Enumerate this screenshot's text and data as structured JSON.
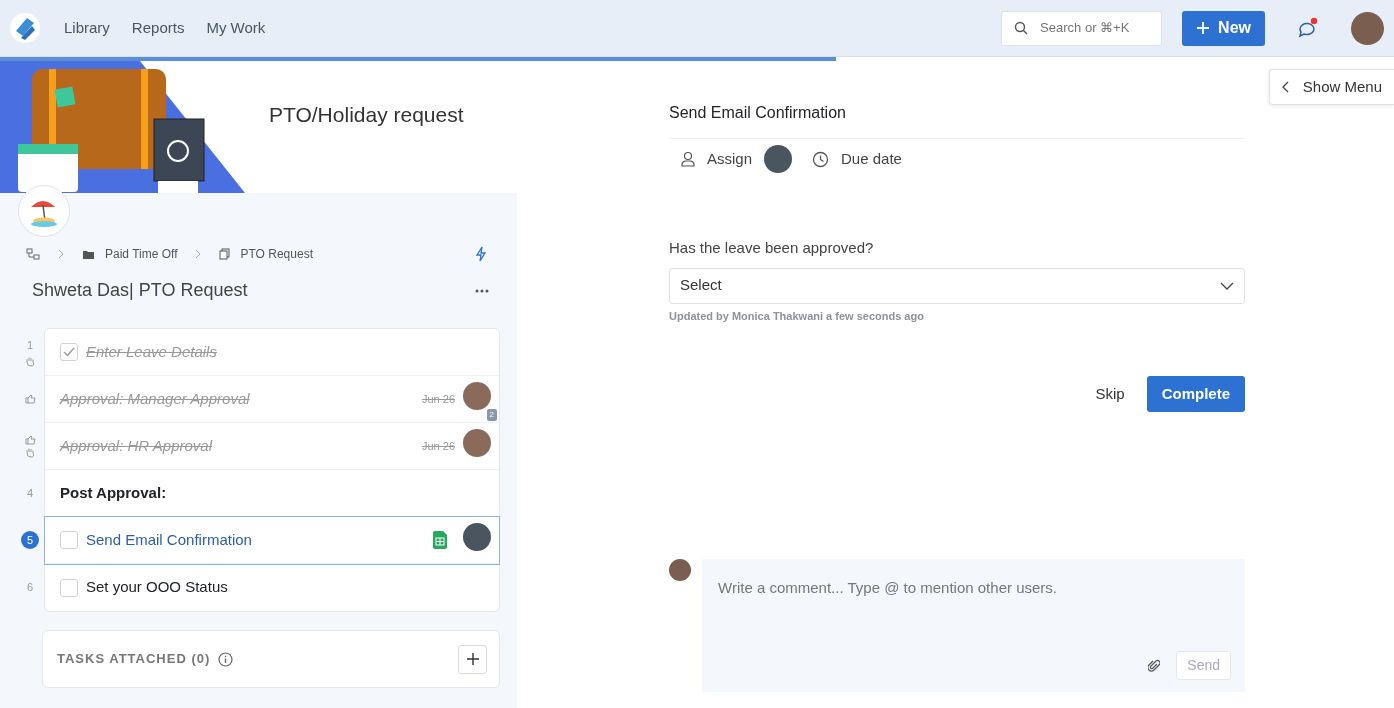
{
  "navbar": {
    "links": [
      {
        "label": "Library"
      },
      {
        "label": "Reports"
      },
      {
        "label": "My Work"
      }
    ],
    "search": {
      "placeholder": "Search or ⌘+K"
    },
    "new_button": "New",
    "chat_unread": true
  },
  "progress": {
    "level": 0.6
  },
  "template_title": "PTO/Holiday request",
  "breadcrumb": [
    {
      "label": "Paid Time Off",
      "kind": "folder"
    },
    {
      "label": "PTO Request",
      "kind": "template"
    }
  ],
  "run_title": "Shweta Das| PTO Request",
  "tasks": [
    {
      "number": "1",
      "kind": "task",
      "title": "Enter Leave Details",
      "done": true,
      "selected": false,
      "stop": true
    },
    {
      "kind": "approval",
      "title": "Approval: Manager Approval",
      "done": true,
      "selected": false,
      "stop": false,
      "date": "Jun 26",
      "assigned": true,
      "badge": "2"
    },
    {
      "kind": "approval",
      "title": "Approval: HR Approval",
      "done": true,
      "selected": false,
      "stop": true,
      "date": "Jun 26",
      "assigned": true
    },
    {
      "number": "4",
      "kind": "heading",
      "title": "Post Approval:",
      "selected": false
    },
    {
      "number": "5",
      "kind": "task",
      "title": "Send Email Confirmation",
      "done": false,
      "selected": true,
      "stop": false,
      "attachment": true,
      "assigned": true
    },
    {
      "number": "6",
      "kind": "task",
      "title": "Set your OOO Status",
      "done": false,
      "selected": false,
      "stop": false
    }
  ],
  "tasks_attached": {
    "label": "TASKS ATTACHED (0)"
  },
  "show_menu": "Show Menu",
  "detail": {
    "title": "Send Email Confirmation",
    "assign": "Assign",
    "due_date": "Due date",
    "question": "Has the leave been approved?",
    "select": {
      "value": "Select"
    },
    "updated": "Updated by Monica Thakwani a few seconds ago",
    "skip": "Skip",
    "complete": "Complete"
  },
  "comment": {
    "placeholder": "Write a comment... Type @ to mention other users.",
    "send": "Send"
  }
}
